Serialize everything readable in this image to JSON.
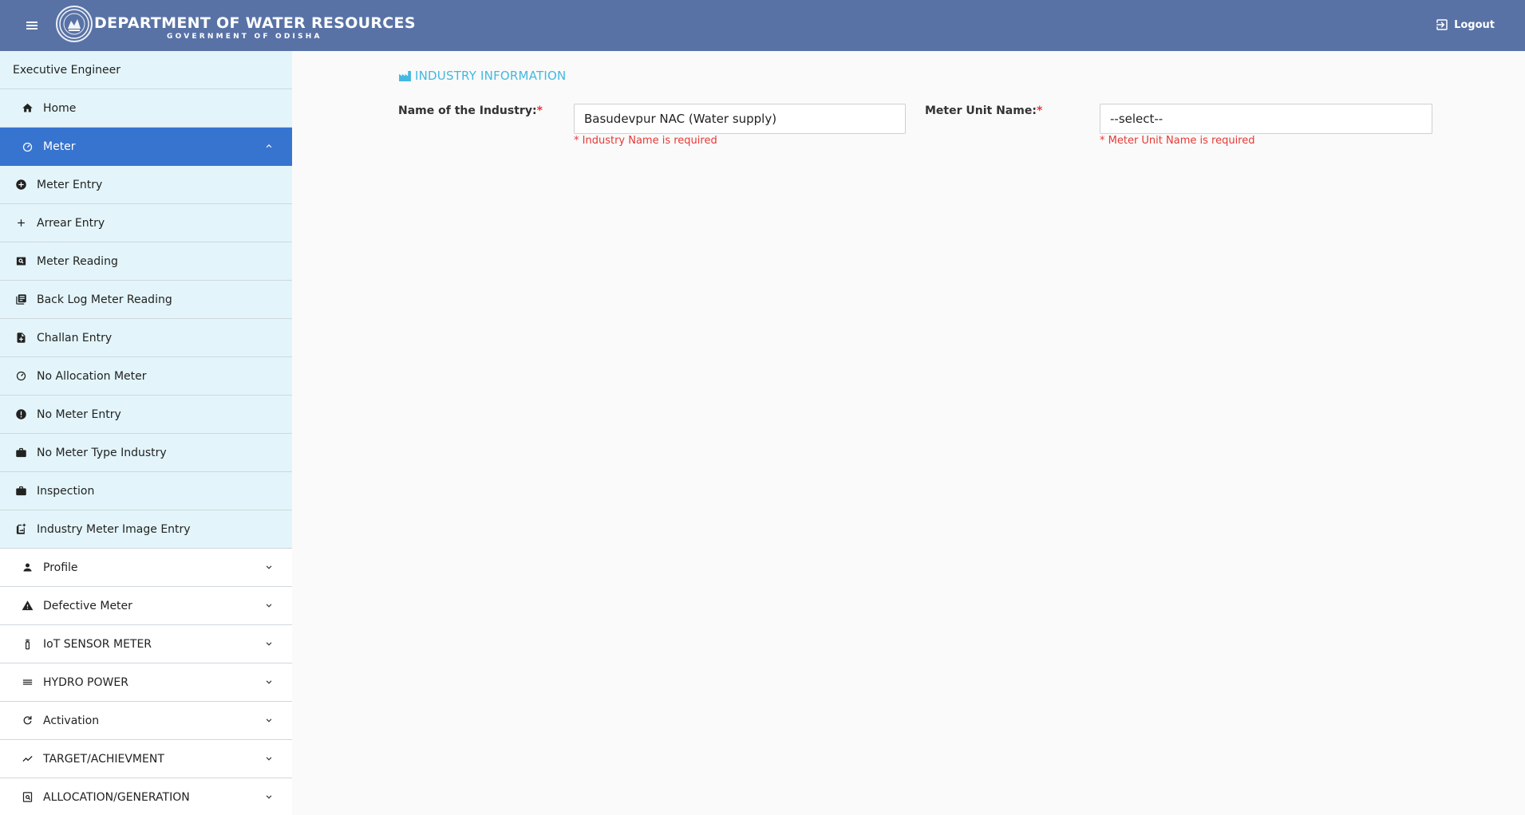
{
  "header": {
    "title": "DEPARTMENT OF WATER RESOURCES",
    "subtitle": "GOVERNMENT OF ODISHA",
    "logout_label": "Logout"
  },
  "sidebar": {
    "role": "Executive Engineer",
    "home": "Home",
    "meter": "Meter",
    "meter_children": [
      {
        "label": "Meter Entry",
        "icon": "plus-circle-icon"
      },
      {
        "label": "Arrear Entry",
        "icon": "plus-icon"
      },
      {
        "label": "Meter Reading",
        "icon": "image-search-icon"
      },
      {
        "label": "Back Log Meter Reading",
        "icon": "library-books-icon"
      },
      {
        "label": "Challan Entry",
        "icon": "note-add-icon"
      },
      {
        "label": "No Allocation Meter",
        "icon": "speedometer-icon"
      },
      {
        "label": "No Meter Entry",
        "icon": "error-icon"
      },
      {
        "label": "No Meter Type Industry",
        "icon": "briefcase-icon"
      },
      {
        "label": "Inspection",
        "icon": "briefcase-icon"
      },
      {
        "label": "Industry Meter Image Entry",
        "icon": "add-photo-icon"
      }
    ],
    "groups": [
      {
        "label": "Profile",
        "icon": "person-icon"
      },
      {
        "label": "Defective Meter",
        "icon": "warning-icon"
      },
      {
        "label": "IoT SENSOR METER",
        "icon": "sensor-icon"
      },
      {
        "label": "HYDRO POWER",
        "icon": "waves-icon"
      },
      {
        "label": "Activation",
        "icon": "refresh-icon"
      },
      {
        "label": "TARGET/ACHIEVMENT",
        "icon": "trending-up-icon"
      },
      {
        "label": "ALLOCATION/GENERATION",
        "icon": "document-search-icon"
      }
    ]
  },
  "main": {
    "section_title": "INDUSTRY INFORMATION",
    "industry_label": "Name of the Industry:",
    "industry_value": "Basudevpur NAC (Water supply)",
    "industry_error": "* Industry Name is required",
    "meter_unit_label": "Meter Unit Name:",
    "meter_unit_value": "--select--",
    "meter_unit_error": "* Meter Unit Name is required",
    "required_mark": "*"
  },
  "colors": {
    "header_bg": "#5872a6",
    "active_nav": "#3674cf",
    "submenu_bg": "#e3f5fa",
    "section_title": "#43b8e0",
    "error": "#e53935"
  }
}
